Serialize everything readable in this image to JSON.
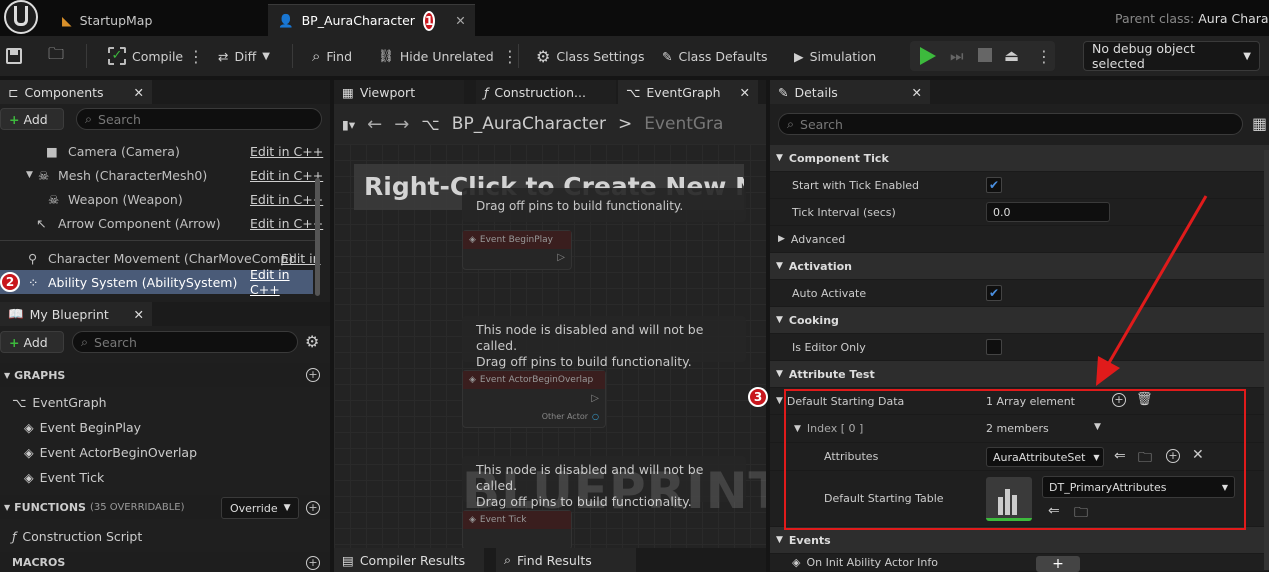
{
  "tabs": {
    "startup": "StartupMap",
    "active": "BP_AuraCharacter",
    "parent_label": "Parent class:",
    "parent_value": "Aura Charact"
  },
  "toolbar": {
    "compile": "Compile",
    "diff": "Diff",
    "find": "Find",
    "hide_unrelated": "Hide Unrelated",
    "class_settings": "Class Settings",
    "class_defaults": "Class Defaults",
    "simulation": "Simulation",
    "debug_object": "No debug object selected"
  },
  "components": {
    "title": "Components",
    "add": "Add",
    "search_placeholder": "Search",
    "edit_label": "Edit in C++",
    "edit_label_clipped": "Edit in",
    "items": [
      "Camera (Camera)",
      "Mesh (CharacterMesh0)",
      "Weapon (Weapon)",
      "Arrow Component (Arrow)",
      "Character Movement (CharMoveComp)",
      "Ability System (AbilitySystem)"
    ]
  },
  "my_blueprint": {
    "title": "My Blueprint",
    "add": "Add",
    "search_placeholder": "Search",
    "graphs_label": "GRAPHS",
    "event_graph": "EventGraph",
    "events": [
      "Event BeginPlay",
      "Event ActorBeginOverlap",
      "Event Tick"
    ],
    "functions_label": "FUNCTIONS",
    "functions_count": "(35 OVERRIDABLE)",
    "override": "Override",
    "construction_script": "Construction Script",
    "macros_label": "MACROS"
  },
  "graph": {
    "tabs": [
      "Viewport",
      "Construction...",
      "EventGraph"
    ],
    "breadcrumb_bp": "BP_AuraCharacter",
    "breadcrumb_graph": "EventGra",
    "hint": "Right-Click to Create New No",
    "disabled_line1": "This node is disabled and will not be called.",
    "disabled_line2": "Drag off pins to build functionality.",
    "event_begin_play": "Event BeginPlay",
    "event_actor_overlap": "Event ActorBeginOverlap",
    "other_actor": "Other Actor",
    "event_tick": "Event Tick",
    "watermark": "BLUEPRINT",
    "bottom_tabs": [
      "Compiler Results",
      "Find Results"
    ]
  },
  "details": {
    "title": "Details",
    "search_placeholder": "Search",
    "component_tick": "Component Tick",
    "start_with_tick": "Start with Tick Enabled",
    "tick_interval": "Tick Interval (secs)",
    "tick_interval_value": "0.0",
    "advanced": "Advanced",
    "activation": "Activation",
    "auto_activate": "Auto Activate",
    "cooking": "Cooking",
    "is_editor_only": "Is Editor Only",
    "attribute_test": "Attribute Test",
    "default_starting_data": "Default Starting Data",
    "array_elements": "1 Array element",
    "index_label": "Index [ 0 ]",
    "members": "2 members",
    "attributes": "Attributes",
    "attribute_set": "AuraAttributeSet",
    "default_starting_table": "Default Starting Table",
    "table_value": "DT_PrimaryAttributes",
    "events": "Events",
    "on_init": "On Init Ability Actor Info"
  },
  "annotations": {
    "n1": "1",
    "n2": "2",
    "n3": "3",
    "accent": "#e01b1b"
  },
  "colors": {
    "play_green": "#3dba3d",
    "check_blue": "#4a8fe0",
    "unreal_blue": "#3a6ad8"
  }
}
